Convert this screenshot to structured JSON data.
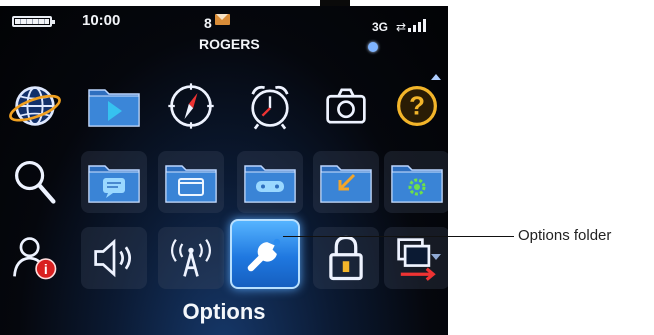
{
  "status_bar": {
    "time": "10:00",
    "unread_count": "8",
    "carrier": "ROGERS",
    "network": "3G",
    "network_arrows": "⇄",
    "battery_icon": "battery-icon",
    "signal_icon": "signal-bars-icon",
    "bluetooth_icon": "bluetooth-icon"
  },
  "home": {
    "selected_label": "Options",
    "apps": [
      {
        "icon": "browser-globe-icon"
      },
      {
        "icon": "media-play-icon"
      },
      {
        "icon": "compass-icon"
      },
      {
        "icon": "alarm-clock-icon"
      },
      {
        "icon": "camera-icon"
      },
      {
        "icon": "help-icon"
      },
      {
        "icon": "search-icon"
      },
      {
        "icon": "messenger-folder-icon"
      },
      {
        "icon": "applications-folder-icon"
      },
      {
        "icon": "games-folder-icon"
      },
      {
        "icon": "downloads-folder-icon"
      },
      {
        "icon": "settings-folder-icon"
      },
      {
        "icon": "setup-wizard-icon"
      },
      {
        "icon": "sound-icon"
      },
      {
        "icon": "manage-connections-icon"
      },
      {
        "icon": "options-wrench-icon",
        "selected": true
      },
      {
        "icon": "lock-icon"
      },
      {
        "icon": "switch-application-icon"
      }
    ]
  },
  "callout": {
    "label": "Options folder"
  },
  "colors": {
    "accent": "#2a8cf0",
    "folder": "#2e6fbf",
    "background": "#05070d"
  }
}
